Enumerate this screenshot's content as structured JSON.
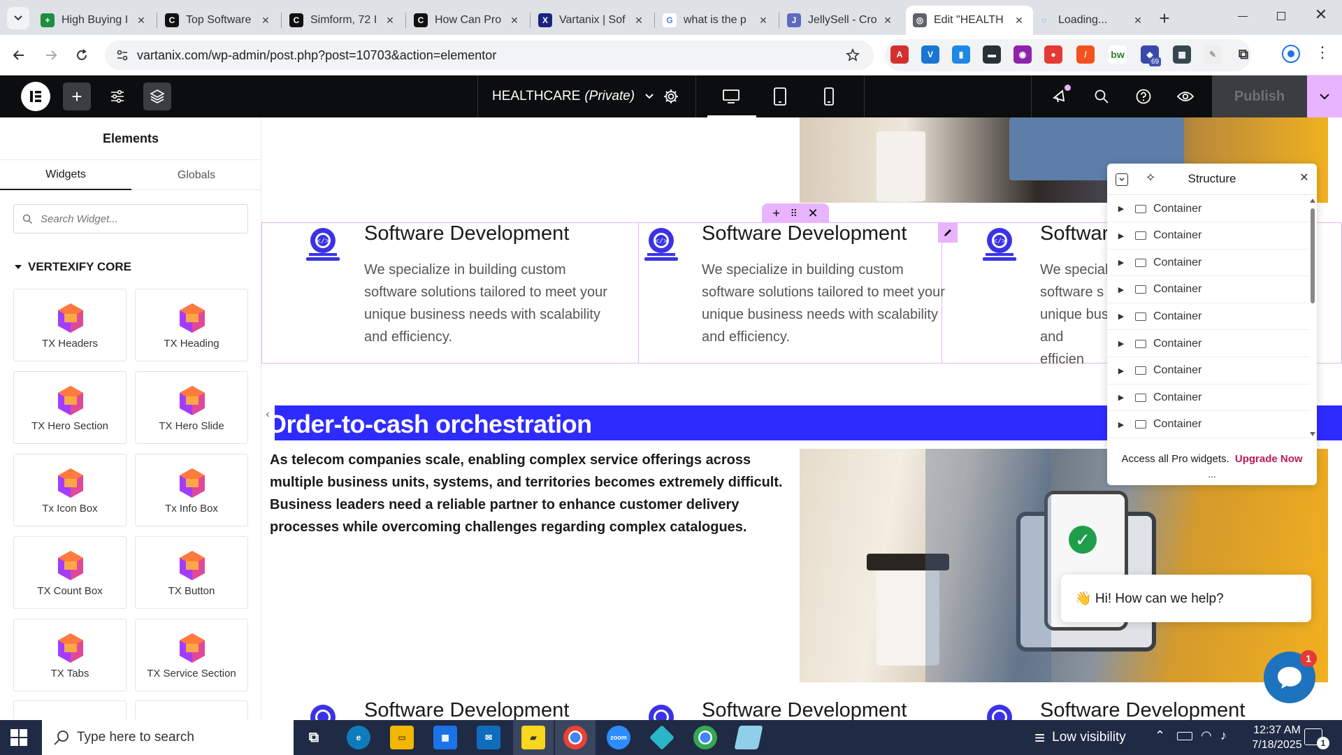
{
  "browser": {
    "tabs": [
      {
        "title": "High Buying I",
        "color": "#1e8e3e",
        "letter": "+"
      },
      {
        "title": "Top Software",
        "color": "#111111",
        "letter": "C"
      },
      {
        "title": "Simform, 72 I",
        "color": "#111111",
        "letter": "C"
      },
      {
        "title": "How Can Pro",
        "color": "#111111",
        "letter": "C"
      },
      {
        "title": "Vartanix | Sof",
        "color": "#1a237e",
        "letter": "X"
      },
      {
        "title": "what is the p",
        "color": "#ffffff",
        "letter": "G"
      },
      {
        "title": "JellySell - Cro",
        "color": "#5c6bc0",
        "letter": "J"
      },
      {
        "title": "Edit \"HEALTH",
        "color": "#5f6368",
        "letter": "◎"
      },
      {
        "title": "Loading...",
        "color": "#dee1e6",
        "letter": "◌"
      }
    ],
    "url": "vartanix.com/wp-admin/post.php?post=10703&action=elementor",
    "ext_badge": "69"
  },
  "editor": {
    "page_title": "HEALTHCARE",
    "page_status": "(Private)",
    "publish_label": "Publish"
  },
  "panel": {
    "heading": "Elements",
    "tabs": [
      "Widgets",
      "Globals"
    ],
    "search_placeholder": "Search Widget...",
    "category": "VERTEXIFY CORE",
    "widgets": [
      "TX Headers",
      "TX Heading",
      "TX Hero Section",
      "TX Hero Slide",
      "Tx Icon Box",
      "Tx Info Box",
      "TX Count Box",
      "TX Button",
      "TX Tabs",
      "TX Service Section"
    ]
  },
  "canvas": {
    "service_title": "Software Development",
    "service_title_partial": "Softwar",
    "service_desc_lines": [
      "We specialize in building custom",
      "software solutions tailored to meet your",
      "unique business needs with scalability",
      "and efficiency."
    ],
    "service_desc_partial_lines": [
      "We special",
      "software s",
      "unique bus",
      "and efficien"
    ],
    "banner_text": "Order-to-cash orchestration",
    "paragraph": "As telecom companies scale, enabling complex service offerings across multiple business units, systems, and territories becomes extremely difficult. Business leaders need a reliable partner to enhance customer delivery processes while overcoming challenges regarding complex catalogues."
  },
  "structure": {
    "title": "Structure",
    "items": [
      "Container",
      "Container",
      "Container",
      "Container",
      "Container",
      "Container",
      "Container",
      "Container",
      "Container"
    ],
    "pro_text": "Access all Pro widgets.",
    "upgrade_label": "Upgrade Now",
    "ellipsis": "..."
  },
  "chat": {
    "greeting": "👋 Hi! How can we help?",
    "badge": "1"
  },
  "taskbar": {
    "search_placeholder": "Type here to search",
    "weather": "Low visibility",
    "time": "12:37 AM",
    "date": "7/18/2025",
    "notif_count": "1"
  },
  "colors": {
    "elementor_black": "#0c0d0e",
    "banner_blue": "#2e2bff",
    "accent_pink": "#e8b4ff",
    "publish_disabled": "#3b3d40",
    "chat_blue": "#1e73be",
    "upgrade_pink": "#c2185b",
    "icon_blue": "#3b32e6"
  }
}
